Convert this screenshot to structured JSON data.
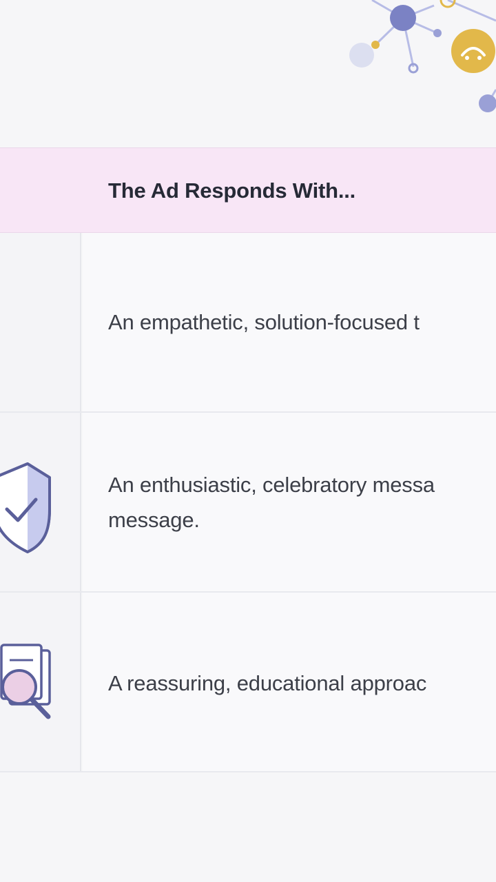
{
  "table": {
    "header": "The Ad Responds With...",
    "rows": [
      {
        "icon": "blank",
        "response": "An empathetic, solution-focused t"
      },
      {
        "icon": "shield-check-icon",
        "response_line1": "An enthusiastic, celebratory messa",
        "response_line2": "message."
      },
      {
        "icon": "document-magnifier-icon",
        "response": "A reassuring, educational approac"
      }
    ]
  },
  "colors": {
    "header_bg": "#f8e6f6",
    "accent_purple": "#7b82c4",
    "accent_yellow": "#e2b84a",
    "text_dark": "#262a36"
  }
}
